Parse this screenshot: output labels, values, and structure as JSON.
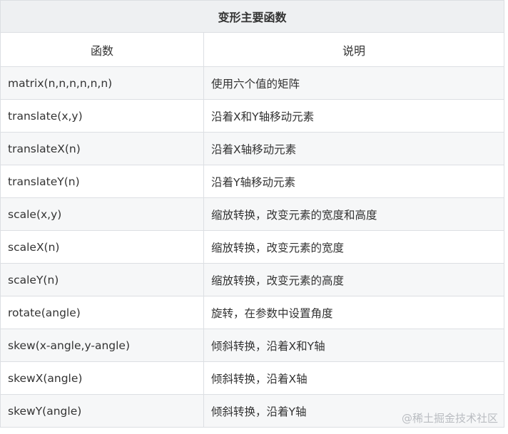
{
  "table": {
    "caption": "变形主要函数",
    "headers": [
      "函数",
      "说明"
    ],
    "rows": [
      {
        "func": "matrix(n,n,n,n,n,n)",
        "desc": "使用六个值的矩阵"
      },
      {
        "func": "translate(x,y)",
        "desc": "沿着X和Y轴移动元素"
      },
      {
        "func": "translateX(n)",
        "desc": "沿着X轴移动元素"
      },
      {
        "func": "translateY(n)",
        "desc": "沿着Y轴移动元素"
      },
      {
        "func": "scale(x,y)",
        "desc": "缩放转换，改变元素的宽度和高度"
      },
      {
        "func": "scaleX(n)",
        "desc": "缩放转换，改变元素的宽度"
      },
      {
        "func": "scaleY(n)",
        "desc": "缩放转换，改变元素的高度"
      },
      {
        "func": "rotate(angle)",
        "desc": "旋转，在参数中设置角度"
      },
      {
        "func": "skew(x-angle,y-angle)",
        "desc": "倾斜转换，沿着X和Y轴"
      },
      {
        "func": "skewX(angle)",
        "desc": "倾斜转换，沿着X轴"
      },
      {
        "func": "skewY(angle)",
        "desc": "倾斜转换，沿着Y轴"
      }
    ]
  },
  "watermark": "@稀土掘金技术社区"
}
